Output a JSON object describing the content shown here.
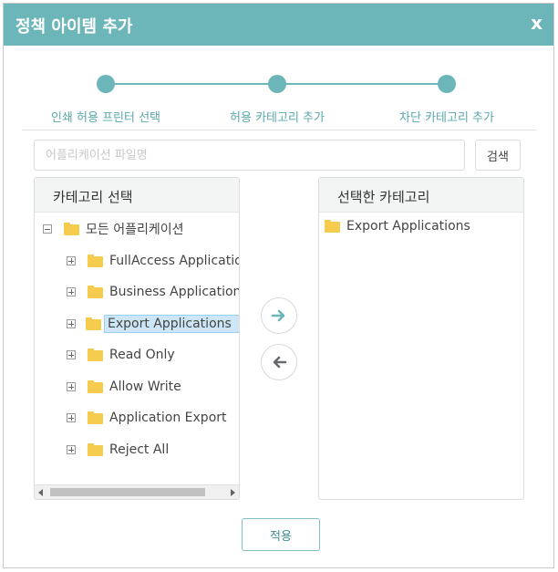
{
  "dialog": {
    "title": "정책 아이템 추가",
    "close_label": "x"
  },
  "stepper": {
    "steps": [
      {
        "label": "인쇄 허용 프린터 선택"
      },
      {
        "label": "허용 카테고리 추가"
      },
      {
        "label": "차단 카테고리 추가"
      }
    ]
  },
  "search": {
    "placeholder": "어플리케이션 파일명",
    "value": "",
    "button_label": "검색"
  },
  "left_panel": {
    "title": "카테고리 선택",
    "root": {
      "label": "모든 어플리케이션",
      "expanded": true
    },
    "children": [
      {
        "label": "FullAccess Applications",
        "expanded": false
      },
      {
        "label": "Business Applications",
        "expanded": false
      },
      {
        "label": "Export Applications",
        "expanded": false,
        "selected": true
      },
      {
        "label": "Read Only",
        "expanded": false
      },
      {
        "label": "Allow Write",
        "expanded": false
      },
      {
        "label": "Application Export",
        "expanded": false
      },
      {
        "label": "Reject All",
        "expanded": false
      }
    ]
  },
  "right_panel": {
    "title": "선택한 카테고리",
    "items": [
      {
        "label": "Export Applications"
      }
    ]
  },
  "actions": {
    "apply_label": "적용"
  },
  "colors": {
    "accent": "#6cb5b8",
    "selected_bg": "#cce6f7",
    "folder": "#f5cc4d"
  },
  "icons": {
    "move_right": "arrow-right-icon",
    "move_left": "arrow-left-icon",
    "folder": "folder-icon"
  }
}
